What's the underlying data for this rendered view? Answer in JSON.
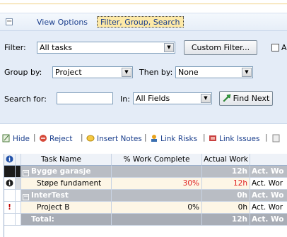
{
  "tabs": {
    "view_options": "View Options",
    "filter_group_search": "Filter, Group, Search"
  },
  "filter": {
    "label": "Filter:",
    "value": "All tasks",
    "custom_button": "Custom Filter...",
    "autofilter_label": "A"
  },
  "group": {
    "label": "Group by:",
    "value": "Project",
    "then_label": "Then by:",
    "then_value": "None"
  },
  "search": {
    "label": "Search for:",
    "value": "",
    "in_label": "In:",
    "in_value": "All Fields",
    "find_next": "Find Next"
  },
  "toolbar": {
    "hide": "Hide",
    "reject": "Reject",
    "insert_notes": "Insert Notes",
    "link_risks": "Link Risks",
    "link_issues": "Link Issues"
  },
  "grid": {
    "headers": {
      "indicator": "i",
      "task_name": "Task Name",
      "work_complete": "% Work Complete",
      "actual_work": "Actual Work",
      "next": ""
    },
    "rows": [
      {
        "kind": "group",
        "name": "Bygge garasje",
        "work_complete": "",
        "actual_work": "12h",
        "next": "Act. Wo"
      },
      {
        "kind": "task",
        "name": "Støpe fundament",
        "work_complete": "30%",
        "actual_work": "12h",
        "next": "Act. Wor"
      },
      {
        "kind": "group",
        "name": "InterTest",
        "work_complete": "",
        "actual_work": "0h",
        "next": "Act. Wo"
      },
      {
        "kind": "task",
        "name": "Project B",
        "work_complete": "0%",
        "actual_work": "0h",
        "next": "Act. Wor"
      },
      {
        "kind": "total",
        "name": "Total:",
        "work_complete": "",
        "actual_work": "12h",
        "next": "Act. Wo"
      }
    ]
  },
  "colors": {
    "panel_bg": "#e4ecf7",
    "active_tab_bg": "#fde9a7",
    "link": "#1a3e8c",
    "group_row": "#b9bdc4",
    "task_row": "#fdf6e6",
    "red_value": "#e02020"
  }
}
